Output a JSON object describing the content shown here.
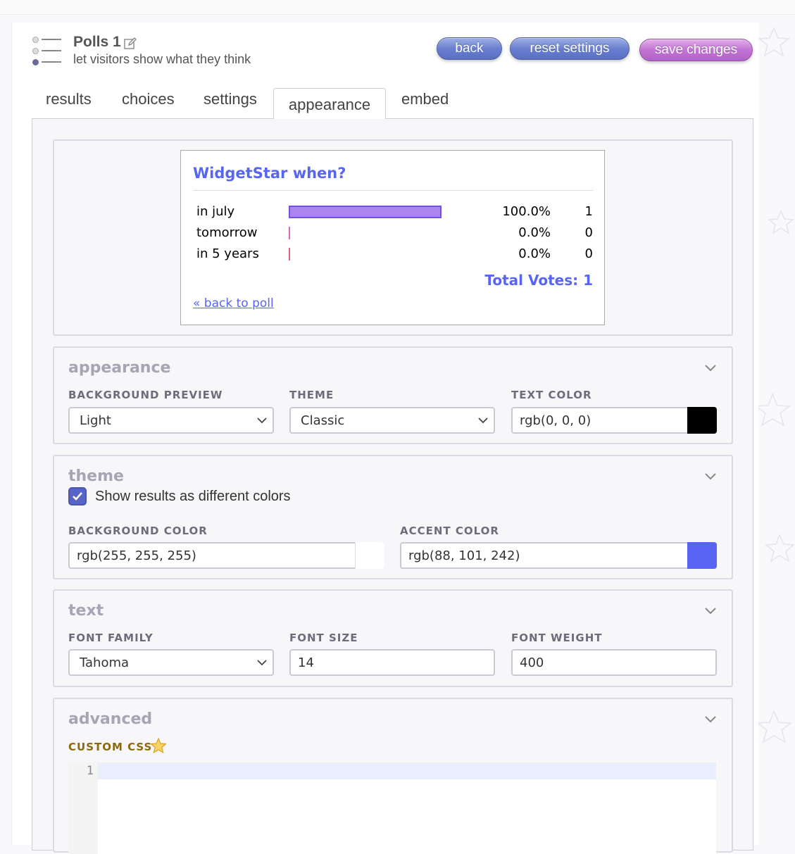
{
  "header": {
    "title": "Polls 1",
    "subtitle": "let visitors show what they think",
    "buttons": {
      "back": "back",
      "reset": "reset settings",
      "save": "save changes"
    }
  },
  "tabs": [
    "results",
    "choices",
    "settings",
    "appearance",
    "embed"
  ],
  "active_tab": "appearance",
  "preview": {
    "question": "WidgetStar when?",
    "rows": [
      {
        "label": "in july",
        "percent": "100.0%",
        "count": "1",
        "fraction": 1.0,
        "color": "#ad85f2"
      },
      {
        "label": "tomorrow",
        "percent": "0.0%",
        "count": "0",
        "fraction": 0.0,
        "color": "#d46ab9"
      },
      {
        "label": "in 5 years",
        "percent": "0.0%",
        "count": "0",
        "fraction": 0.0,
        "color": "#e0607a"
      }
    ],
    "total": "Total Votes: 1",
    "back_link": "« back to poll"
  },
  "appearance": {
    "title": "appearance",
    "bg_preview_label": "BACKGROUND PREVIEW",
    "bg_preview_value": "Light",
    "theme_label": "THEME",
    "theme_value": "Classic",
    "text_color_label": "TEXT COLOR",
    "text_color_value": "rgb(0, 0, 0)",
    "text_color_swatch": "#000000"
  },
  "theme": {
    "title": "theme",
    "checkbox_label": "Show results as different colors",
    "checked": true,
    "bg_color_label": "BACKGROUND COLOR",
    "bg_color_value": "rgb(255, 255, 255)",
    "bg_color_swatch": "#ffffff",
    "accent_label": "ACCENT COLOR",
    "accent_value": "rgb(88, 101, 242)",
    "accent_swatch": "#5865f2"
  },
  "text": {
    "title": "text",
    "font_family_label": "FONT FAMILY",
    "font_family_value": "Tahoma",
    "font_size_label": "FONT SIZE",
    "font_size_value": "14",
    "font_weight_label": "FONT WEIGHT",
    "font_weight_value": "400"
  },
  "advanced": {
    "title": "advanced",
    "custom_css_label": "CUSTOM CSS",
    "line_number": "1"
  }
}
